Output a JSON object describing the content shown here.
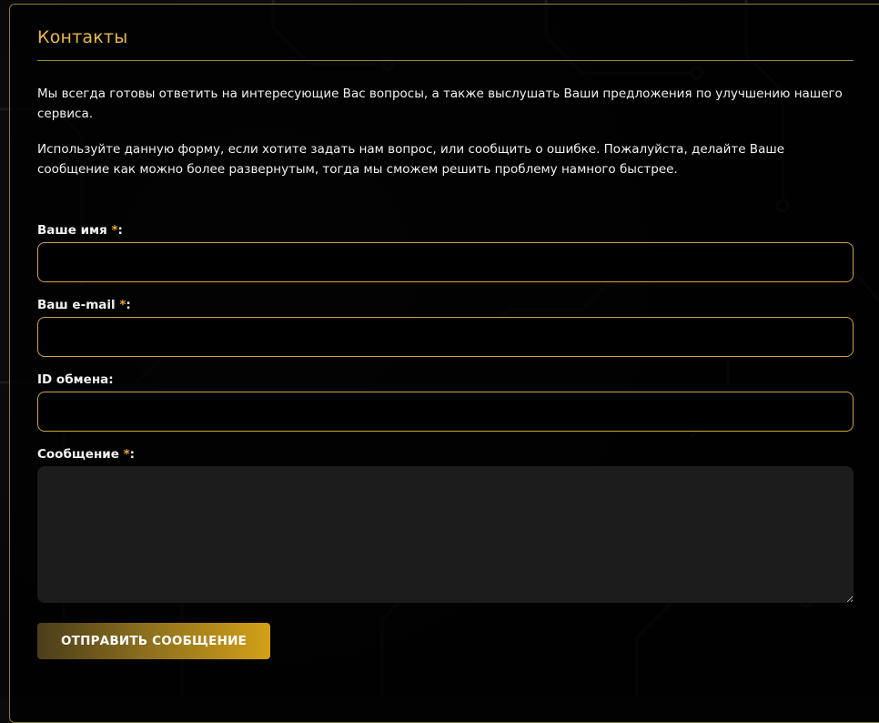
{
  "contacts": {
    "title": "Контакты",
    "intro": [
      "Мы всегда готовы ответить на интересующие Вас вопросы, а также выслушать Ваши предложения по улучшению нашего сервиса.",
      "Используйте данную форму, если хотите задать нам вопрос, или сообщить о ошибке. Пожалуйста, делайте Ваше сообщение как можно более развернутым, тогда мы сможем решить проблему намного быстрее."
    ],
    "required_marker": "*",
    "fields": {
      "name": {
        "label": "Ваше имя",
        "suffix": ":",
        "value": ""
      },
      "email": {
        "label": "Ваш e-mail",
        "suffix": ":",
        "value": ""
      },
      "exchange_id": {
        "label": "ID обмена:",
        "value": ""
      },
      "message": {
        "label": "Сообщение",
        "suffix": ":",
        "value": ""
      }
    },
    "submit_label": "ОТПРАВИТЬ СООБЩЕНИЕ"
  },
  "colors": {
    "accent": "#e8b84a",
    "field_border": "#c9a547",
    "required": "#e8a838",
    "button_start": "#4a3d1a",
    "button_end": "#d4a017"
  }
}
